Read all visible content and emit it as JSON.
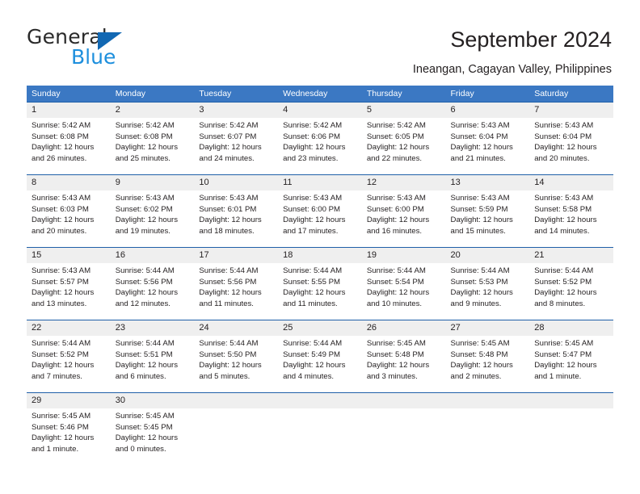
{
  "brand": {
    "name_part1": "General",
    "name_part2": "Blue",
    "triangle_color": "#1268b3",
    "blue_color": "#1d8fdd"
  },
  "header": {
    "title": "September 2024",
    "subtitle": "Ineangan, Cagayan Valley, Philippines"
  },
  "theme": {
    "header_bg": "#3b78c3",
    "row_separator": "#1f5fa8",
    "daynum_bg": "#efefef",
    "text": "#231f20"
  },
  "calendar": {
    "weekdays": [
      "Sunday",
      "Monday",
      "Tuesday",
      "Wednesday",
      "Thursday",
      "Friday",
      "Saturday"
    ],
    "weeks": [
      [
        {
          "day": "1",
          "sunrise": "Sunrise: 5:42 AM",
          "sunset": "Sunset: 6:08 PM",
          "daylight1": "Daylight: 12 hours",
          "daylight2": "and 26 minutes."
        },
        {
          "day": "2",
          "sunrise": "Sunrise: 5:42 AM",
          "sunset": "Sunset: 6:08 PM",
          "daylight1": "Daylight: 12 hours",
          "daylight2": "and 25 minutes."
        },
        {
          "day": "3",
          "sunrise": "Sunrise: 5:42 AM",
          "sunset": "Sunset: 6:07 PM",
          "daylight1": "Daylight: 12 hours",
          "daylight2": "and 24 minutes."
        },
        {
          "day": "4",
          "sunrise": "Sunrise: 5:42 AM",
          "sunset": "Sunset: 6:06 PM",
          "daylight1": "Daylight: 12 hours",
          "daylight2": "and 23 minutes."
        },
        {
          "day": "5",
          "sunrise": "Sunrise: 5:42 AM",
          "sunset": "Sunset: 6:05 PM",
          "daylight1": "Daylight: 12 hours",
          "daylight2": "and 22 minutes."
        },
        {
          "day": "6",
          "sunrise": "Sunrise: 5:43 AM",
          "sunset": "Sunset: 6:04 PM",
          "daylight1": "Daylight: 12 hours",
          "daylight2": "and 21 minutes."
        },
        {
          "day": "7",
          "sunrise": "Sunrise: 5:43 AM",
          "sunset": "Sunset: 6:04 PM",
          "daylight1": "Daylight: 12 hours",
          "daylight2": "and 20 minutes."
        }
      ],
      [
        {
          "day": "8",
          "sunrise": "Sunrise: 5:43 AM",
          "sunset": "Sunset: 6:03 PM",
          "daylight1": "Daylight: 12 hours",
          "daylight2": "and 20 minutes."
        },
        {
          "day": "9",
          "sunrise": "Sunrise: 5:43 AM",
          "sunset": "Sunset: 6:02 PM",
          "daylight1": "Daylight: 12 hours",
          "daylight2": "and 19 minutes."
        },
        {
          "day": "10",
          "sunrise": "Sunrise: 5:43 AM",
          "sunset": "Sunset: 6:01 PM",
          "daylight1": "Daylight: 12 hours",
          "daylight2": "and 18 minutes."
        },
        {
          "day": "11",
          "sunrise": "Sunrise: 5:43 AM",
          "sunset": "Sunset: 6:00 PM",
          "daylight1": "Daylight: 12 hours",
          "daylight2": "and 17 minutes."
        },
        {
          "day": "12",
          "sunrise": "Sunrise: 5:43 AM",
          "sunset": "Sunset: 6:00 PM",
          "daylight1": "Daylight: 12 hours",
          "daylight2": "and 16 minutes."
        },
        {
          "day": "13",
          "sunrise": "Sunrise: 5:43 AM",
          "sunset": "Sunset: 5:59 PM",
          "daylight1": "Daylight: 12 hours",
          "daylight2": "and 15 minutes."
        },
        {
          "day": "14",
          "sunrise": "Sunrise: 5:43 AM",
          "sunset": "Sunset: 5:58 PM",
          "daylight1": "Daylight: 12 hours",
          "daylight2": "and 14 minutes."
        }
      ],
      [
        {
          "day": "15",
          "sunrise": "Sunrise: 5:43 AM",
          "sunset": "Sunset: 5:57 PM",
          "daylight1": "Daylight: 12 hours",
          "daylight2": "and 13 minutes."
        },
        {
          "day": "16",
          "sunrise": "Sunrise: 5:44 AM",
          "sunset": "Sunset: 5:56 PM",
          "daylight1": "Daylight: 12 hours",
          "daylight2": "and 12 minutes."
        },
        {
          "day": "17",
          "sunrise": "Sunrise: 5:44 AM",
          "sunset": "Sunset: 5:56 PM",
          "daylight1": "Daylight: 12 hours",
          "daylight2": "and 11 minutes."
        },
        {
          "day": "18",
          "sunrise": "Sunrise: 5:44 AM",
          "sunset": "Sunset: 5:55 PM",
          "daylight1": "Daylight: 12 hours",
          "daylight2": "and 11 minutes."
        },
        {
          "day": "19",
          "sunrise": "Sunrise: 5:44 AM",
          "sunset": "Sunset: 5:54 PM",
          "daylight1": "Daylight: 12 hours",
          "daylight2": "and 10 minutes."
        },
        {
          "day": "20",
          "sunrise": "Sunrise: 5:44 AM",
          "sunset": "Sunset: 5:53 PM",
          "daylight1": "Daylight: 12 hours",
          "daylight2": "and 9 minutes."
        },
        {
          "day": "21",
          "sunrise": "Sunrise: 5:44 AM",
          "sunset": "Sunset: 5:52 PM",
          "daylight1": "Daylight: 12 hours",
          "daylight2": "and 8 minutes."
        }
      ],
      [
        {
          "day": "22",
          "sunrise": "Sunrise: 5:44 AM",
          "sunset": "Sunset: 5:52 PM",
          "daylight1": "Daylight: 12 hours",
          "daylight2": "and 7 minutes."
        },
        {
          "day": "23",
          "sunrise": "Sunrise: 5:44 AM",
          "sunset": "Sunset: 5:51 PM",
          "daylight1": "Daylight: 12 hours",
          "daylight2": "and 6 minutes."
        },
        {
          "day": "24",
          "sunrise": "Sunrise: 5:44 AM",
          "sunset": "Sunset: 5:50 PM",
          "daylight1": "Daylight: 12 hours",
          "daylight2": "and 5 minutes."
        },
        {
          "day": "25",
          "sunrise": "Sunrise: 5:44 AM",
          "sunset": "Sunset: 5:49 PM",
          "daylight1": "Daylight: 12 hours",
          "daylight2": "and 4 minutes."
        },
        {
          "day": "26",
          "sunrise": "Sunrise: 5:45 AM",
          "sunset": "Sunset: 5:48 PM",
          "daylight1": "Daylight: 12 hours",
          "daylight2": "and 3 minutes."
        },
        {
          "day": "27",
          "sunrise": "Sunrise: 5:45 AM",
          "sunset": "Sunset: 5:48 PM",
          "daylight1": "Daylight: 12 hours",
          "daylight2": "and 2 minutes."
        },
        {
          "day": "28",
          "sunrise": "Sunrise: 5:45 AM",
          "sunset": "Sunset: 5:47 PM",
          "daylight1": "Daylight: 12 hours",
          "daylight2": "and 1 minute."
        }
      ],
      [
        {
          "day": "29",
          "sunrise": "Sunrise: 5:45 AM",
          "sunset": "Sunset: 5:46 PM",
          "daylight1": "Daylight: 12 hours",
          "daylight2": "and 1 minute."
        },
        {
          "day": "30",
          "sunrise": "Sunrise: 5:45 AM",
          "sunset": "Sunset: 5:45 PM",
          "daylight1": "Daylight: 12 hours",
          "daylight2": "and 0 minutes."
        },
        {
          "day": "",
          "sunrise": "",
          "sunset": "",
          "daylight1": "",
          "daylight2": ""
        },
        {
          "day": "",
          "sunrise": "",
          "sunset": "",
          "daylight1": "",
          "daylight2": ""
        },
        {
          "day": "",
          "sunrise": "",
          "sunset": "",
          "daylight1": "",
          "daylight2": ""
        },
        {
          "day": "",
          "sunrise": "",
          "sunset": "",
          "daylight1": "",
          "daylight2": ""
        },
        {
          "day": "",
          "sunrise": "",
          "sunset": "",
          "daylight1": "",
          "daylight2": ""
        }
      ]
    ]
  }
}
